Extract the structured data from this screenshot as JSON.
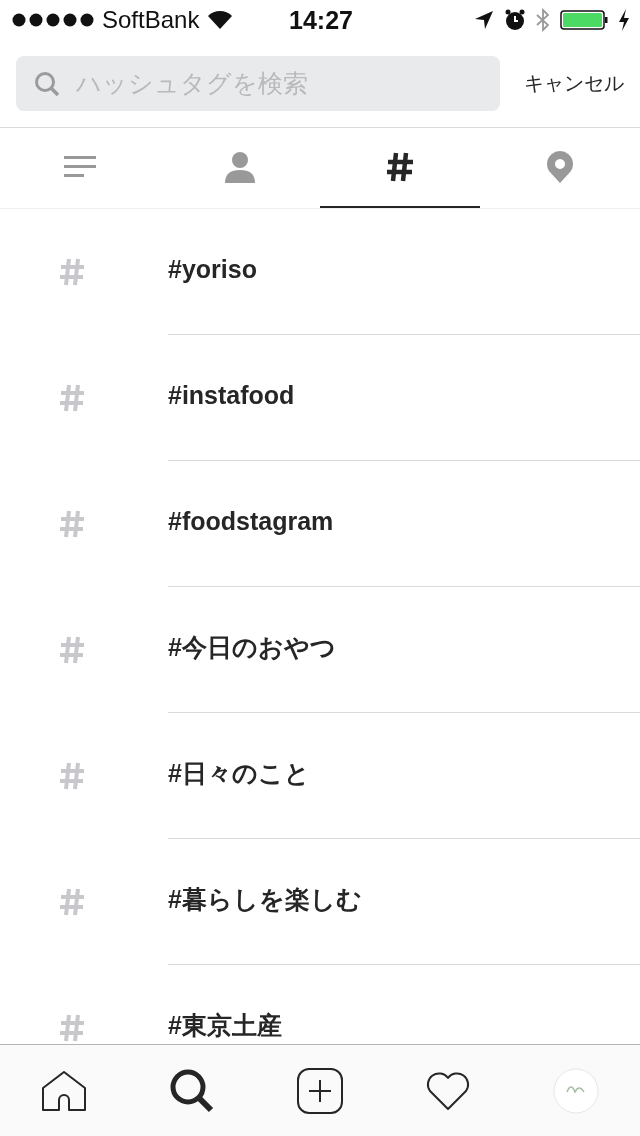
{
  "status_bar": {
    "carrier": "SoftBank",
    "time": "14:27"
  },
  "search": {
    "placeholder": "ハッシュタグを検索",
    "cancel": "キャンセル"
  },
  "tabs": [
    {
      "kind": "top",
      "selected": false
    },
    {
      "kind": "people",
      "selected": false
    },
    {
      "kind": "tags",
      "selected": true
    },
    {
      "kind": "places",
      "selected": false
    }
  ],
  "hashtags": [
    {
      "label": "#yoriso"
    },
    {
      "label": "#instafood"
    },
    {
      "label": "#foodstagram"
    },
    {
      "label": "#今日のおやつ"
    },
    {
      "label": "#日々のこと"
    },
    {
      "label": "#暮らしを楽しむ"
    },
    {
      "label": "#東京土産"
    }
  ],
  "nav": [
    {
      "kind": "home",
      "selected": false
    },
    {
      "kind": "search",
      "selected": true
    },
    {
      "kind": "add",
      "selected": false
    },
    {
      "kind": "activity",
      "selected": false
    },
    {
      "kind": "profile",
      "selected": false
    }
  ]
}
